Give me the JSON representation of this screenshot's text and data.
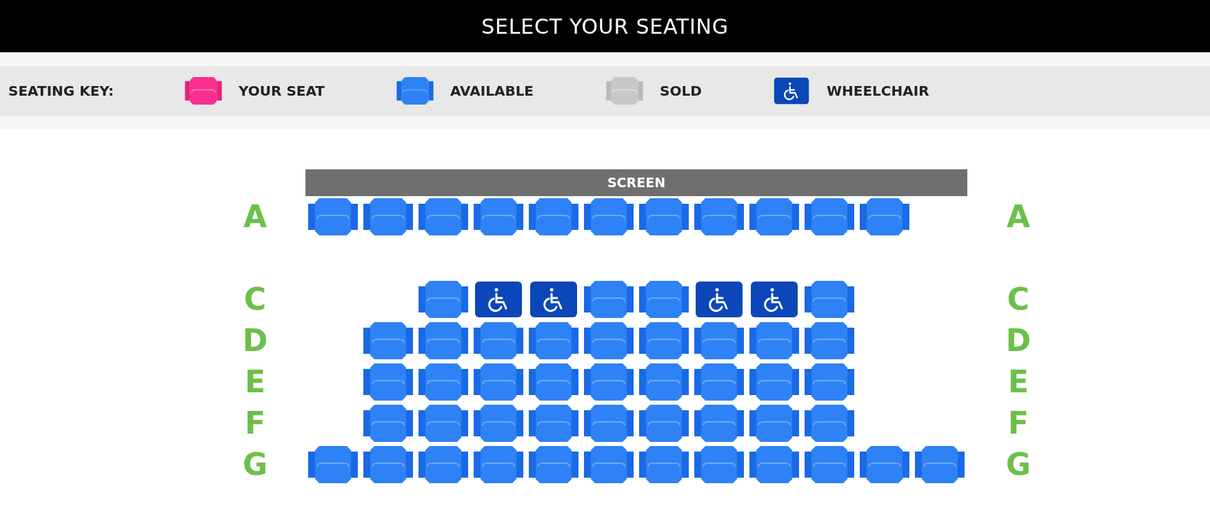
{
  "header": {
    "title": "SELECT YOUR SEATING"
  },
  "key": {
    "title": "SEATING KEY:",
    "items": [
      {
        "kind": "yours",
        "label": "YOUR SEAT"
      },
      {
        "kind": "available",
        "label": "AVAILABLE"
      },
      {
        "kind": "sold",
        "label": "SOLD"
      },
      {
        "kind": "wheelchair",
        "label": "WHEELCHAIR"
      }
    ]
  },
  "screen": {
    "label": "SCREEN"
  },
  "rows": [
    {
      "kind": "seats",
      "label_left": "A",
      "label_right": "A",
      "seats": [
        {
          "kind": "available"
        },
        {
          "kind": "available"
        },
        {
          "kind": "available"
        },
        {
          "kind": "available"
        },
        {
          "kind": "available"
        },
        {
          "kind": "available"
        },
        {
          "kind": "available"
        },
        {
          "kind": "available"
        },
        {
          "kind": "available"
        },
        {
          "kind": "available"
        },
        {
          "kind": "available"
        }
      ]
    },
    {
      "kind": "gap"
    },
    {
      "kind": "seats",
      "label_left": "C",
      "label_right": "C",
      "seats": [
        {
          "kind": "space"
        },
        {
          "kind": "space"
        },
        {
          "kind": "available"
        },
        {
          "kind": "wheelchair"
        },
        {
          "kind": "wheelchair"
        },
        {
          "kind": "available"
        },
        {
          "kind": "available"
        },
        {
          "kind": "wheelchair"
        },
        {
          "kind": "wheelchair"
        },
        {
          "kind": "available"
        }
      ]
    },
    {
      "kind": "seats",
      "label_left": "D",
      "label_right": "D",
      "seats": [
        {
          "kind": "space"
        },
        {
          "kind": "available"
        },
        {
          "kind": "available"
        },
        {
          "kind": "available"
        },
        {
          "kind": "available"
        },
        {
          "kind": "available"
        },
        {
          "kind": "available"
        },
        {
          "kind": "available"
        },
        {
          "kind": "available"
        },
        {
          "kind": "available"
        }
      ]
    },
    {
      "kind": "seats",
      "label_left": "E",
      "label_right": "E",
      "seats": [
        {
          "kind": "space"
        },
        {
          "kind": "available"
        },
        {
          "kind": "available"
        },
        {
          "kind": "available"
        },
        {
          "kind": "available"
        },
        {
          "kind": "available"
        },
        {
          "kind": "available"
        },
        {
          "kind": "available"
        },
        {
          "kind": "available"
        },
        {
          "kind": "available"
        }
      ]
    },
    {
      "kind": "seats",
      "label_left": "F",
      "label_right": "F",
      "seats": [
        {
          "kind": "space"
        },
        {
          "kind": "available"
        },
        {
          "kind": "available"
        },
        {
          "kind": "available"
        },
        {
          "kind": "available"
        },
        {
          "kind": "available"
        },
        {
          "kind": "available"
        },
        {
          "kind": "available"
        },
        {
          "kind": "available"
        },
        {
          "kind": "available"
        }
      ]
    },
    {
      "kind": "seats",
      "label_left": "G",
      "label_right": "G",
      "seats": [
        {
          "kind": "available"
        },
        {
          "kind": "available"
        },
        {
          "kind": "available"
        },
        {
          "kind": "available"
        },
        {
          "kind": "available"
        },
        {
          "kind": "available"
        },
        {
          "kind": "available"
        },
        {
          "kind": "available"
        },
        {
          "kind": "available"
        },
        {
          "kind": "available"
        },
        {
          "kind": "available"
        },
        {
          "kind": "available"
        }
      ]
    }
  ]
}
